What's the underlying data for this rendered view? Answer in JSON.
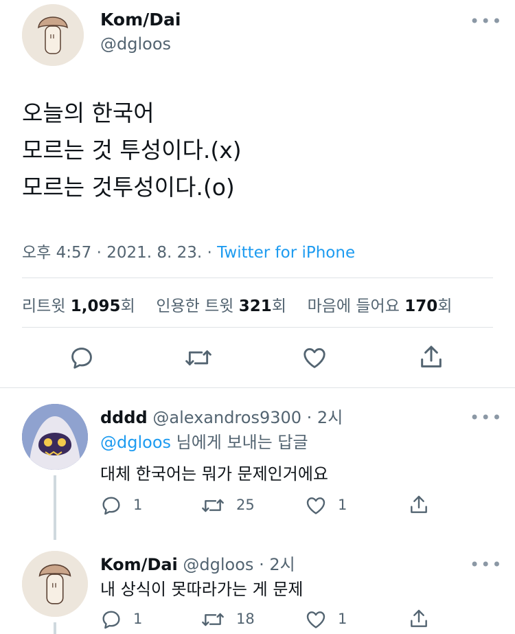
{
  "main_tweet": {
    "display_name": "Kom/Dai",
    "handle": "@dgloos",
    "lines": [
      "오늘의 한국어",
      "모르는 것 투성이다.(x)",
      "모르는 것투성이다.(o)"
    ],
    "timestamp": "오후 4:57 · 2021. 8. 23. · ",
    "source": "Twitter for iPhone",
    "stats": {
      "retweets_label": "리트윗 ",
      "retweets_count": "1,095",
      "retweets_unit": "회",
      "quotes_label": "인용한 트윗 ",
      "quotes_count": "321",
      "quotes_unit": "회",
      "likes_label": "마음에 들어요 ",
      "likes_count": "170",
      "likes_unit": "회"
    },
    "more_label": "•••"
  },
  "replies": [
    {
      "display_name": "dddd",
      "handle": "@alexandros9300",
      "time": " · 2시",
      "reply_to_handle": "@dgloos",
      "reply_to_suffix": " 님에게 보내는 답글",
      "text": "대체 한국어는 뭐가 문제인거에요",
      "reply_count": "1",
      "retweet_count": "25",
      "like_count": "1",
      "more_label": "•••"
    },
    {
      "display_name": "Kom/Dai",
      "handle": "@dgloos",
      "time": " · 2시",
      "text": "내 상식이 못따라가는 게 문제",
      "reply_count": "1",
      "retweet_count": "18",
      "like_count": "1",
      "more_label": "•••"
    }
  ],
  "colors": {
    "accent": "#1d9bf0",
    "text": "#0f1419",
    "secondary": "#536471",
    "divider": "#dfe3e6"
  }
}
